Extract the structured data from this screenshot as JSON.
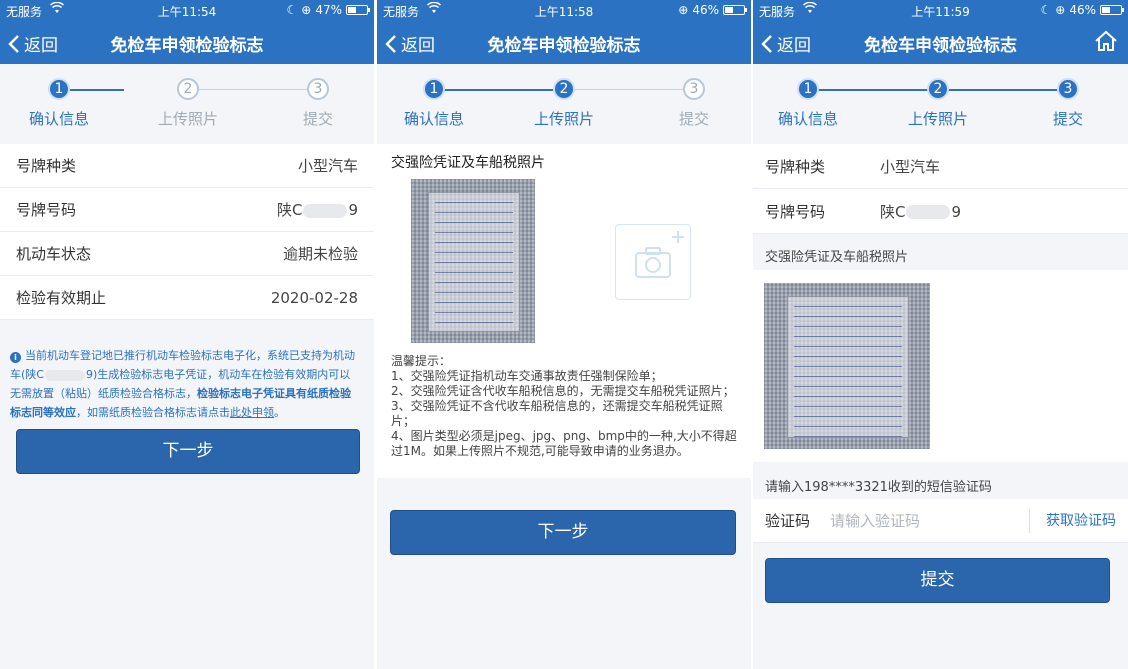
{
  "status": {
    "carrier": "无服务",
    "screens": [
      {
        "time": "上午11:54",
        "battery": "47%",
        "battery_level": 0.47
      },
      {
        "time": "上午11:58",
        "battery": "46%",
        "battery_level": 0.46
      },
      {
        "time": "上午11:59",
        "battery": "46%",
        "battery_level": 0.46
      }
    ]
  },
  "nav": {
    "back_label": "返回",
    "title": "免检车申领检验标志"
  },
  "steps": [
    {
      "num": "1",
      "label": "确认信息"
    },
    {
      "num": "2",
      "label": "上传照片"
    },
    {
      "num": "3",
      "label": "提交"
    }
  ],
  "screen1": {
    "rows": [
      {
        "label": "号牌种类",
        "value": "小型汽车"
      },
      {
        "label": "号牌号码",
        "value_prefix": "陕C",
        "value_suffix": "9"
      },
      {
        "label": "机动车状态",
        "value": "逾期未检验"
      },
      {
        "label": "检验有效期止",
        "value": "2020-02-28"
      }
    ],
    "notice": {
      "part1": "当前机动车登记地已推行机动车检验标志电子化，系统已支持为机动车(陕C",
      "part2": "9)生成检验标志电子凭证，机动车在检验有效期内可以无需放置（粘贴）纸质检验合格标志，",
      "bold": "检验标志电子凭证具有纸质检验标志同等效应",
      "part3": "，如需纸质检验合格标志请点击",
      "link": "此处申领",
      "part4": "。"
    },
    "next_button": "下一步"
  },
  "screen2": {
    "section_title": "交强险凭证及车船税照片",
    "tips_title": "温馨提示：",
    "tips": [
      "1、交强险凭证指机动车交通事故责任强制保险单；",
      "2、交强险凭证含代收车船税信息的，无需提交车船税凭证照片；",
      "3、交强险凭证不含代收车船税信息的，还需提交车船税凭证照片；",
      "4、图片类型必须是jpeg、jpg、png、bmp中的一种,大小不得超过1M。如果上传照片不规范,可能导致申请的业务退办。"
    ],
    "next_button": "下一步"
  },
  "screen3": {
    "rows": [
      {
        "label": "号牌种类",
        "value": "小型汽车"
      },
      {
        "label": "号牌号码",
        "value_prefix": "陕C",
        "value_suffix": "9"
      }
    ],
    "photo_section_title": "交强险凭证及车船税照片",
    "sms_hint": "请输入198****3321收到的短信验证码",
    "code_label": "验证码",
    "code_placeholder": "请输入验证码",
    "get_code": "获取验证码",
    "submit_button": "提交"
  },
  "colors": {
    "brand": "#2b72c3",
    "button": "#2b66ad"
  },
  "icons": [
    "wifi-icon",
    "moon-icon",
    "rotation-lock-icon",
    "battery-icon",
    "back-chevron-icon",
    "home-icon",
    "camera-plus-icon",
    "info-icon"
  ]
}
